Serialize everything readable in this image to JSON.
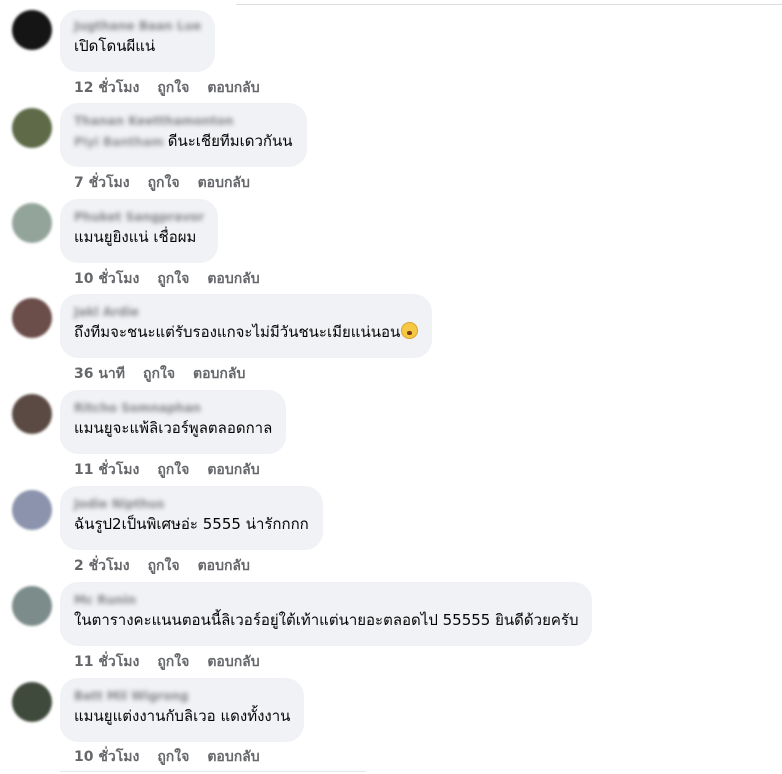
{
  "comments": [
    {
      "author": "Jugthane Baan Lue",
      "text": "เปิดโดนผีแน่",
      "time": "12 ชั่วโมง",
      "like": "ถูกใจ",
      "reply": "ตอบกลับ",
      "avatar_color": "#151515"
    },
    {
      "author": "Thanan Keetthamonton",
      "tag": "Piyi Bantham",
      "text": "ดีนะเชียทีมเดวกันน",
      "time": "7 ชั่วโมง",
      "like": "ถูกใจ",
      "reply": "ตอบกลับ",
      "avatar_color": "#5e6a48"
    },
    {
      "author": "Phuket Sangpravor",
      "text": "แมนยูยิงแน่ เชื่อผม",
      "time": "10 ชั่วโมง",
      "like": "ถูกใจ",
      "reply": "ตอบกลับ",
      "avatar_color": "#93a59b"
    },
    {
      "author": "Jakl Ardie",
      "text": "ถึงทีมจะชนะแต่รับรองแกจะไม่มีวันชนะเมียแน่นอน",
      "time": "36 นาที",
      "like": "ถูกใจ",
      "reply": "ตอบกลับ",
      "avatar_color": "#6b4d4a",
      "emoji": "astonished-face-icon"
    },
    {
      "author": "Ritcho Somnaphan",
      "text": "แมนยูจะแพ้ลิเวอร์พูลตลอดกาล",
      "time": "11 ชั่วโมง",
      "like": "ถูกใจ",
      "reply": "ตอบกลับ",
      "avatar_color": "#5a4a43"
    },
    {
      "author": "Jodie Nipthus",
      "text": "ฉันรูป2เป็นพิเศษอ่ะ 5555 น่ารักกกก",
      "time": "2 ชั่วโมง",
      "like": "ถูกใจ",
      "reply": "ตอบกลับ",
      "avatar_color": "#8c93ad"
    },
    {
      "author": "Mc Runin",
      "text": "ในตารางคะแนนตอนนี้ลิเวอร์อยู่ใต้เท้าแต่นายอะตลอดไป 55555 ยินดีด้วยครับ",
      "time": "11 ชั่วโมง",
      "like": "ถูกใจ",
      "reply": "ตอบกลับ",
      "avatar_color": "#7b8c8a"
    },
    {
      "author": "Batt Mil Wigrong",
      "text": "แมนยูแต่งงานกับลิเวอ แดงทั้งงาน",
      "time": "10 ชั่วโมง",
      "like": "ถูกใจ",
      "reply": "ตอบกลับ",
      "avatar_color": "#3f4a3c"
    }
  ]
}
